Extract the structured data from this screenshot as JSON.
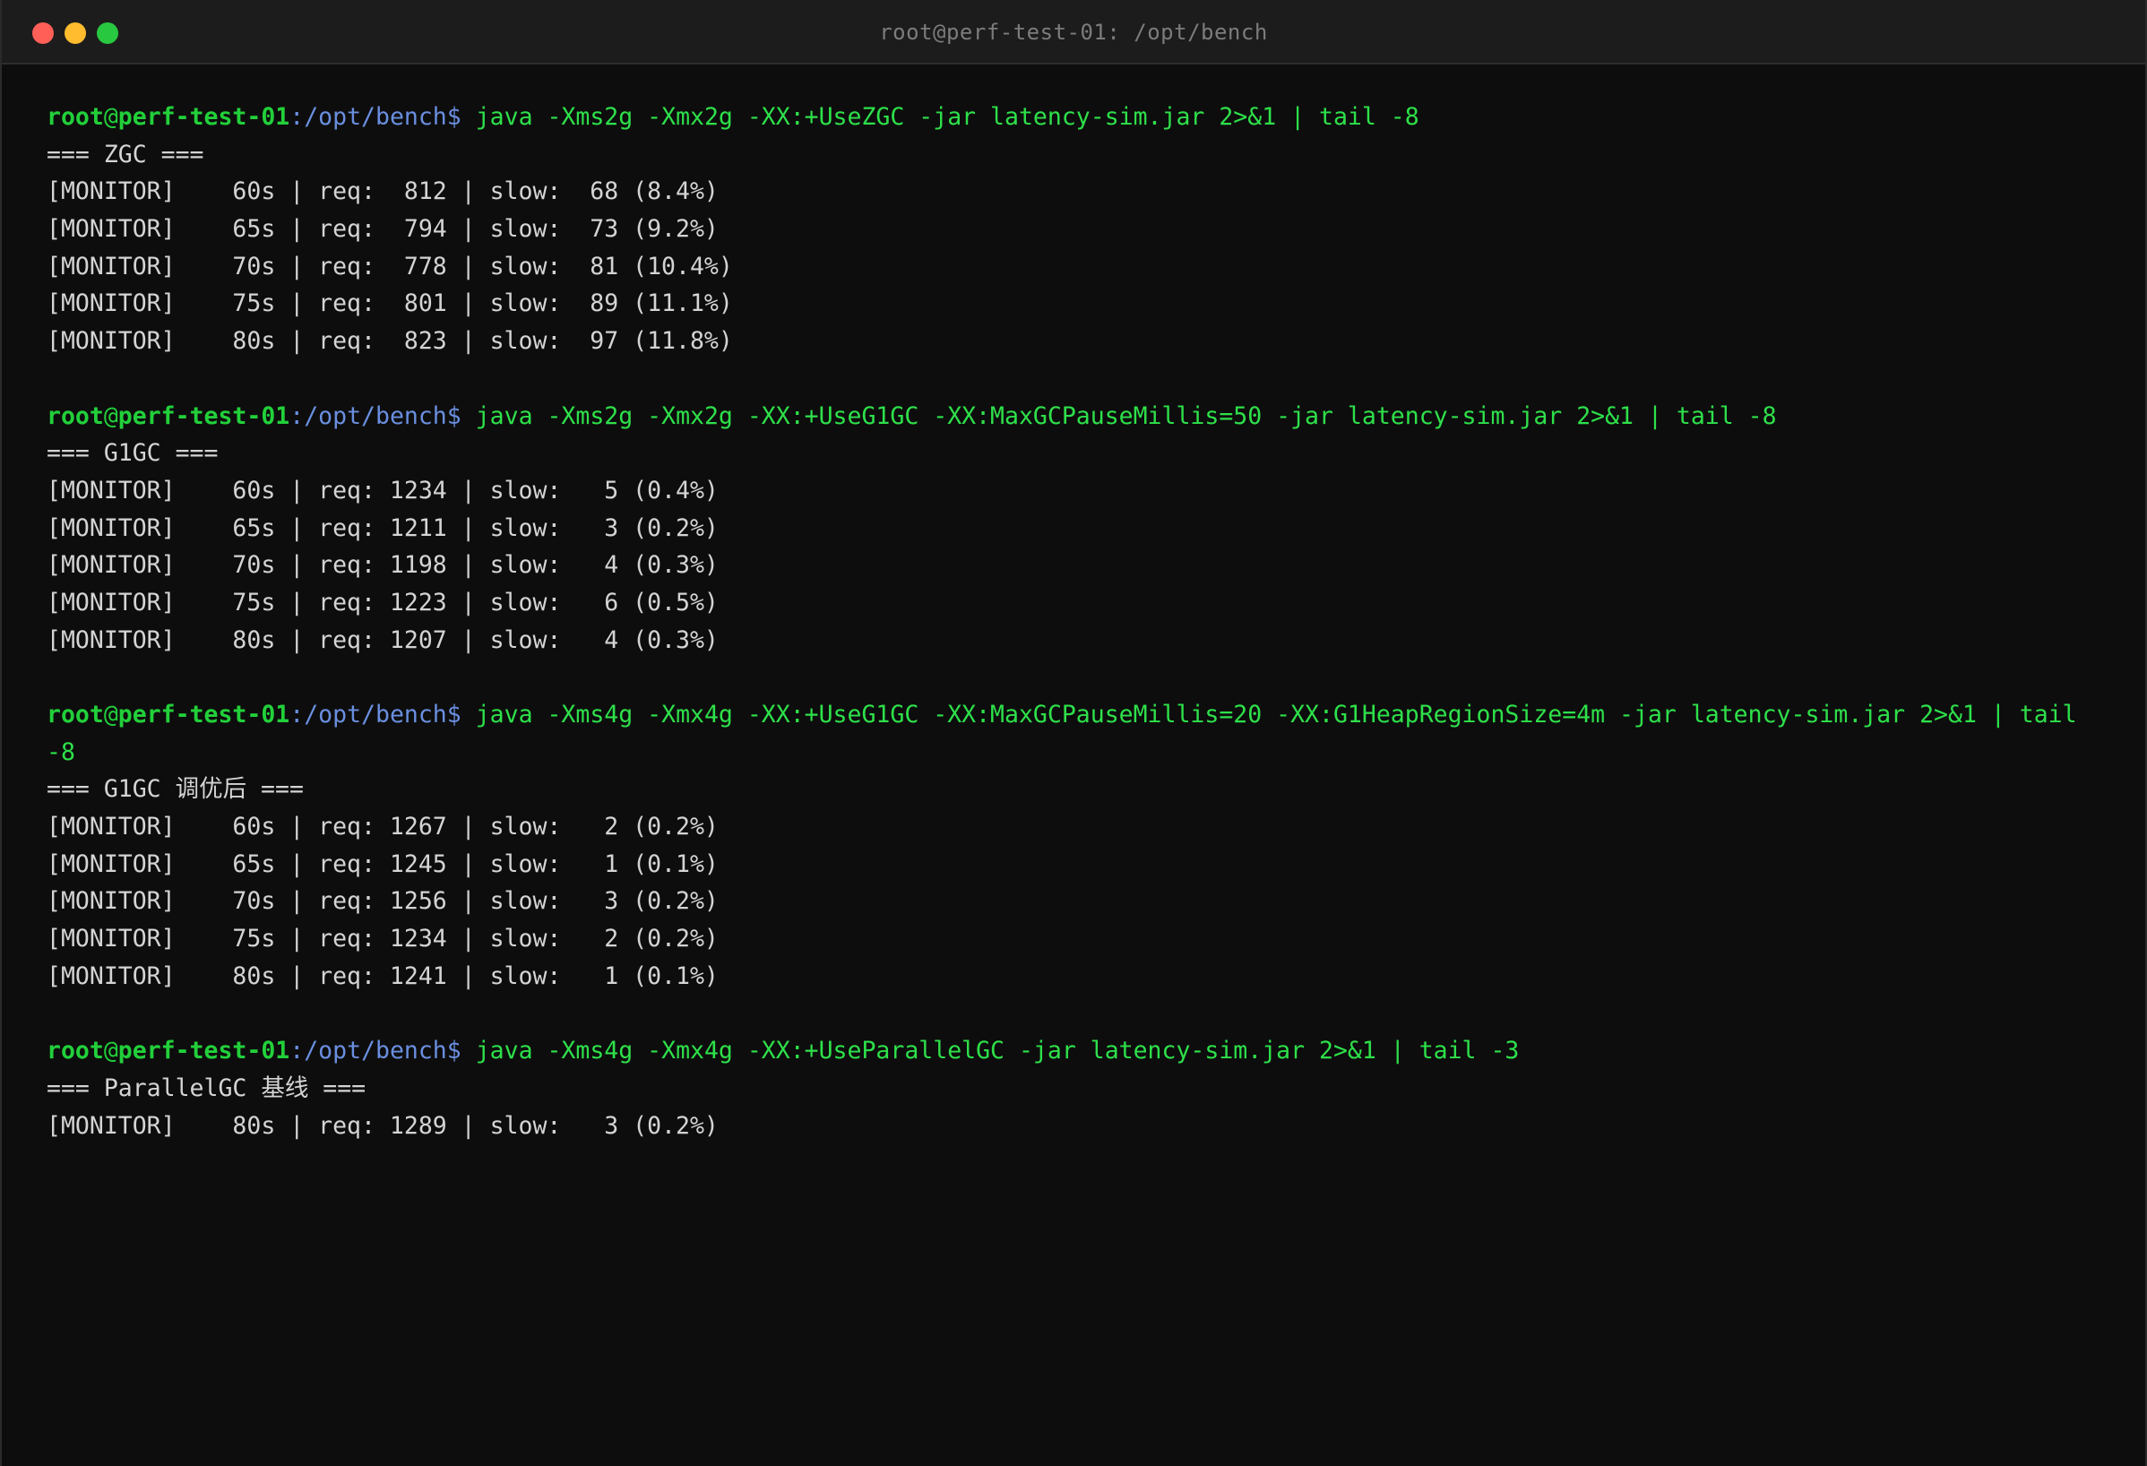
{
  "window": {
    "title": "root@perf-test-01: /opt/bench",
    "buttons": [
      "close",
      "minimize",
      "maximize"
    ]
  },
  "colors": {
    "background": "#0d0d0d",
    "titlebar": "#1c1c1c",
    "prompt_user": "#22d03a",
    "prompt_path": "#6a8fe0",
    "command": "#2ee04a",
    "output": "#d4d4d4"
  },
  "prompt": {
    "user": "root",
    "at": "@",
    "host": "perf-test-01",
    "colon": ":",
    "path": "/opt/bench",
    "dollar": "$"
  },
  "blocks": [
    {
      "command": "java -Xms2g -Xmx2g -XX:+UseZGC -jar latency-sim.jar 2>&1 | tail -8",
      "command_cont": "",
      "output": [
        "=== ZGC ===",
        "[MONITOR]    60s | req:  812 | slow:  68 (8.4%)",
        "[MONITOR]    65s | req:  794 | slow:  73 (9.2%)",
        "[MONITOR]    70s | req:  778 | slow:  81 (10.4%)",
        "[MONITOR]    75s | req:  801 | slow:  89 (11.1%)",
        "[MONITOR]    80s | req:  823 | slow:  97 (11.8%)"
      ]
    },
    {
      "command": "java -Xms2g -Xmx2g -XX:+UseG1GC -XX:MaxGCPauseMillis=50 -jar latency-sim.jar 2>&1 | tail -8",
      "command_cont": "",
      "output": [
        "=== G1GC ===",
        "[MONITOR]    60s | req: 1234 | slow:   5 (0.4%)",
        "[MONITOR]    65s | req: 1211 | slow:   3 (0.2%)",
        "[MONITOR]    70s | req: 1198 | slow:   4 (0.3%)",
        "[MONITOR]    75s | req: 1223 | slow:   6 (0.5%)",
        "[MONITOR]    80s | req: 1207 | slow:   4 (0.3%)"
      ]
    },
    {
      "command": "java -Xms4g -Xmx4g -XX:+UseG1GC -XX:MaxGCPauseMillis=20 -XX:G1HeapRegionSize=4m -jar latency-sim.jar 2>&1 | tail",
      "command_cont": "-8",
      "output": [
        "=== G1GC 调优后 ===",
        "[MONITOR]    60s | req: 1267 | slow:   2 (0.2%)",
        "[MONITOR]    65s | req: 1245 | slow:   1 (0.1%)",
        "[MONITOR]    70s | req: 1256 | slow:   3 (0.2%)",
        "[MONITOR]    75s | req: 1234 | slow:   2 (0.2%)",
        "[MONITOR]    80s | req: 1241 | slow:   1 (0.1%)"
      ]
    },
    {
      "command": "java -Xms4g -Xmx4g -XX:+UseParallelGC -jar latency-sim.jar 2>&1 | tail -3",
      "command_cont": "",
      "output": [
        "=== ParallelGC 基线 ===",
        "[MONITOR]    80s | req: 1289 | slow:   3 (0.2%)"
      ]
    }
  ]
}
